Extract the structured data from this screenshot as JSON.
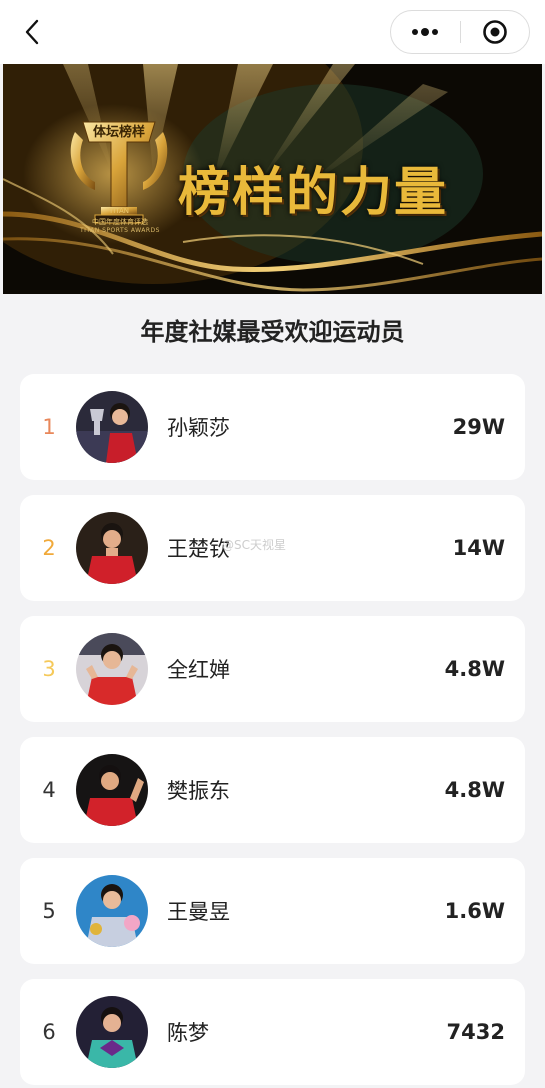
{
  "nav": {
    "back_icon": "chevron-left-icon",
    "more_icon": "more-dots-icon",
    "close_icon": "target-close-icon"
  },
  "banner": {
    "trophy_title": "体坛榜样",
    "trophy_brand": "TITAN",
    "trophy_cn": "中国年度体育评选",
    "trophy_en": "TITAN SPORTS AWARDS",
    "headline": "榜样的力量"
  },
  "title": "年度社媒最受欢迎运动员",
  "watermark": "@SC天视星",
  "colors": {
    "rank1": "#e8875a",
    "rank2": "#f0a93a",
    "rank3": "#f5c95a",
    "rank_default": "#333333"
  },
  "list": [
    {
      "rank": "1",
      "name": "孙颖莎",
      "count": "29W"
    },
    {
      "rank": "2",
      "name": "王楚钦",
      "count": "14W"
    },
    {
      "rank": "3",
      "name": "全红婵",
      "count": "4.8W"
    },
    {
      "rank": "4",
      "name": "樊振东",
      "count": "4.8W"
    },
    {
      "rank": "5",
      "name": "王曼昱",
      "count": "1.6W"
    },
    {
      "rank": "6",
      "name": "陈梦",
      "count": "7432"
    }
  ]
}
